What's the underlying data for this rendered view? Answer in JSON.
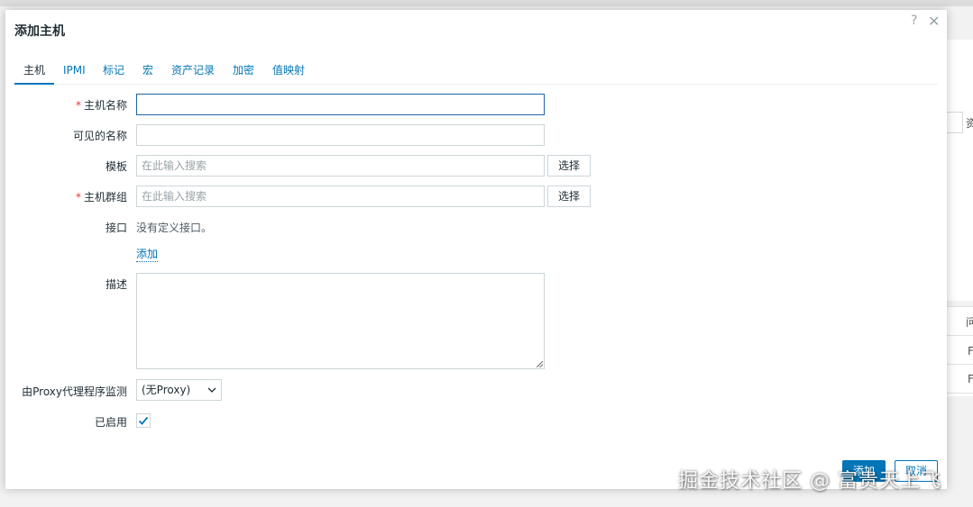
{
  "dialog": {
    "title": "添加主机",
    "help_icon": "?",
    "close_icon": "✕"
  },
  "tabs": [
    {
      "label": "主机",
      "active": true
    },
    {
      "label": "IPMI",
      "active": false
    },
    {
      "label": "标记",
      "active": false
    },
    {
      "label": "宏",
      "active": false
    },
    {
      "label": "资产记录",
      "active": false
    },
    {
      "label": "加密",
      "active": false
    },
    {
      "label": "值映射",
      "active": false
    }
  ],
  "form": {
    "required_mark": "*",
    "host_name": {
      "label": "主机名称",
      "value": ""
    },
    "visible_name": {
      "label": "可见的名称",
      "value": ""
    },
    "templates": {
      "label": "模板",
      "placeholder": "在此输入搜索",
      "button": "选择"
    },
    "host_groups": {
      "label": "主机群组",
      "placeholder": "在此输入搜索",
      "button": "选择"
    },
    "interfaces": {
      "label": "接口",
      "empty_text": "没有定义接口。",
      "add_link": "添加"
    },
    "description": {
      "label": "描述",
      "value": ""
    },
    "proxy": {
      "label": "由Proxy代理程序监测",
      "selected": "(无Proxy)"
    },
    "enabled": {
      "label": "已启用",
      "checked": true
    }
  },
  "footer": {
    "add_button": "添加",
    "cancel_button": "取消"
  },
  "background": {
    "fragments": [
      "资",
      "问",
      "F",
      "F"
    ]
  },
  "watermark": "掘金技术社区 @ 富贵天上飞",
  "colors": {
    "accent": "#0275b8",
    "required": "#e33734",
    "focus_border": "#1f65a6"
  }
}
